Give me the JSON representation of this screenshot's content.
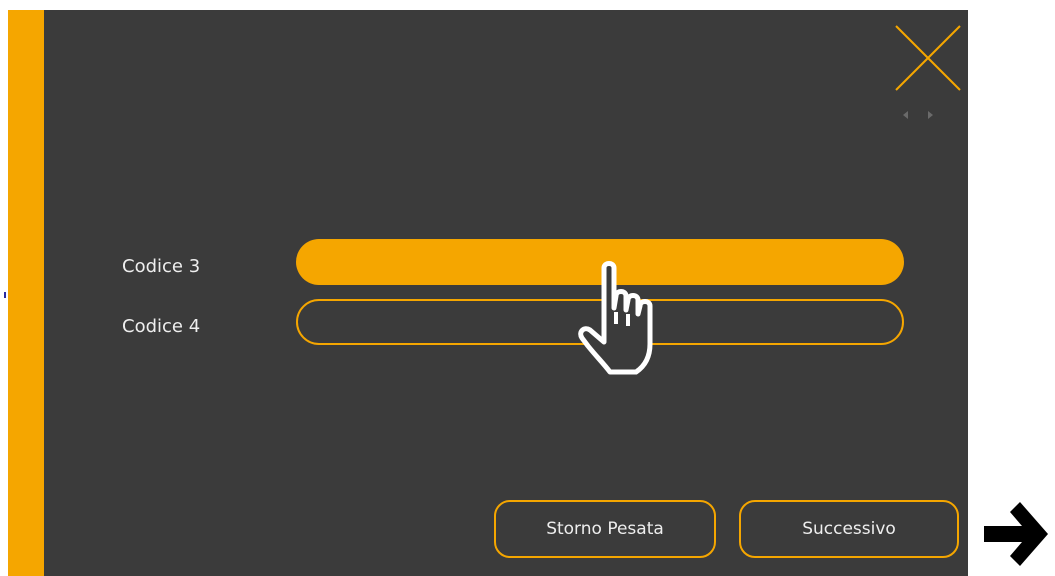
{
  "form": {
    "fields": [
      {
        "label": "Codice 3",
        "value": "",
        "state": "active"
      },
      {
        "label": "Codice 4",
        "value": "",
        "state": "idle"
      }
    ]
  },
  "buttons": {
    "storno_label": "Storno Pesata",
    "next_label": "Successivo"
  },
  "icons": {
    "close": "close-icon",
    "page_nav": "page-arrows-icon",
    "pointer": "hand-pointer-icon",
    "next_arrow": "right-arrow-icon"
  },
  "colors": {
    "accent": "#f5a600",
    "background": "#3b3b3b",
    "text": "#eeeeee"
  }
}
